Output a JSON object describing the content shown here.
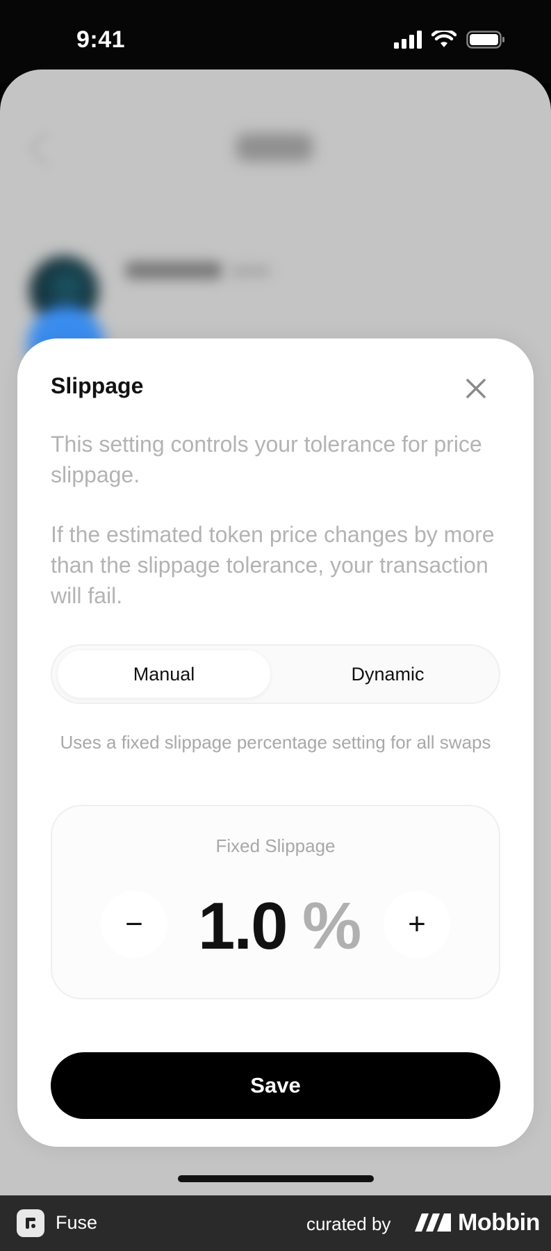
{
  "status_bar": {
    "time": "9:41"
  },
  "sheet": {
    "title": "Slippage",
    "description_1": "This setting controls your tolerance for price slippage.",
    "description_2": "If the estimated token price changes by more than the slippage tolerance, your transaction will fail.",
    "tabs": [
      {
        "label": "Manual",
        "active": true
      },
      {
        "label": "Dynamic",
        "active": false
      }
    ],
    "mode_description": "Uses a fixed slippage percentage setting for all swaps",
    "fixed_slippage": {
      "label": "Fixed Slippage",
      "value": "1.0",
      "unit": "%",
      "decrement_label": "−",
      "increment_label": "+"
    },
    "save_label": "Save"
  },
  "footer": {
    "app_name": "Fuse",
    "curated_by": "curated by",
    "brand": "Mobbin"
  },
  "colors": {
    "primary": "#000000",
    "muted_text": "#b3b3b3",
    "footer_bg": "#2a2a2a"
  }
}
